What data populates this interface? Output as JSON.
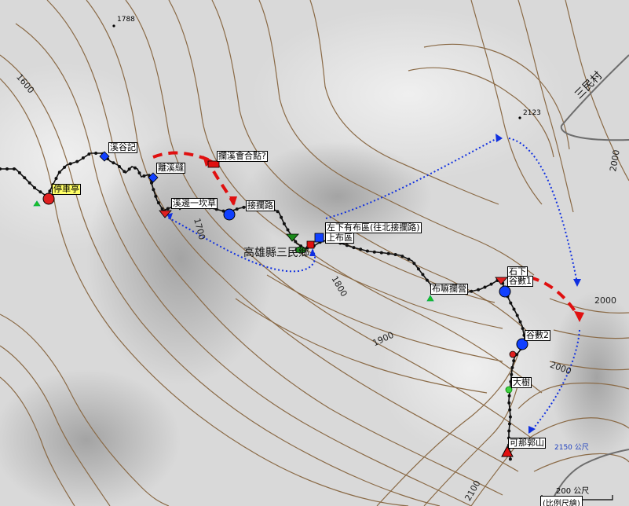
{
  "map": {
    "colors": {
      "background": "#d9d9d9",
      "contour": "#8a6a46",
      "road": "#6e6e6e",
      "trail": "#111111",
      "dotted_route": "#1030e0",
      "dashed_route": "#e01010"
    },
    "waypoints": {
      "parking": "停車亭",
      "stream_valley": "溪谷記",
      "leave_stream": "離溪縫",
      "detour_junction": "攔溪會合點?",
      "creek_grass": "溪邊一坎草",
      "join_road": "接攔路",
      "road_fork": "左下有布區(往北接攔路)",
      "lower_buildup": "上布區",
      "bubu_camp": "布嘛攔營",
      "rock_shelter": "石下",
      "valley1": "谷數1",
      "valley2": "谷數2",
      "big_tree": "大樹",
      "summit": "可那郭山"
    },
    "contour_labels": [
      "1600",
      "1700",
      "1800",
      "1900",
      "2000",
      "2000",
      "2000",
      "2100"
    ],
    "peaks": [
      "1788",
      "2123"
    ],
    "county_label": "高雄縣三民鄉",
    "district_label": "三民村",
    "summit_altitude": "2150 公尺",
    "scale_label": "200 公尺",
    "footer_note": "(比例尺繪)"
  }
}
